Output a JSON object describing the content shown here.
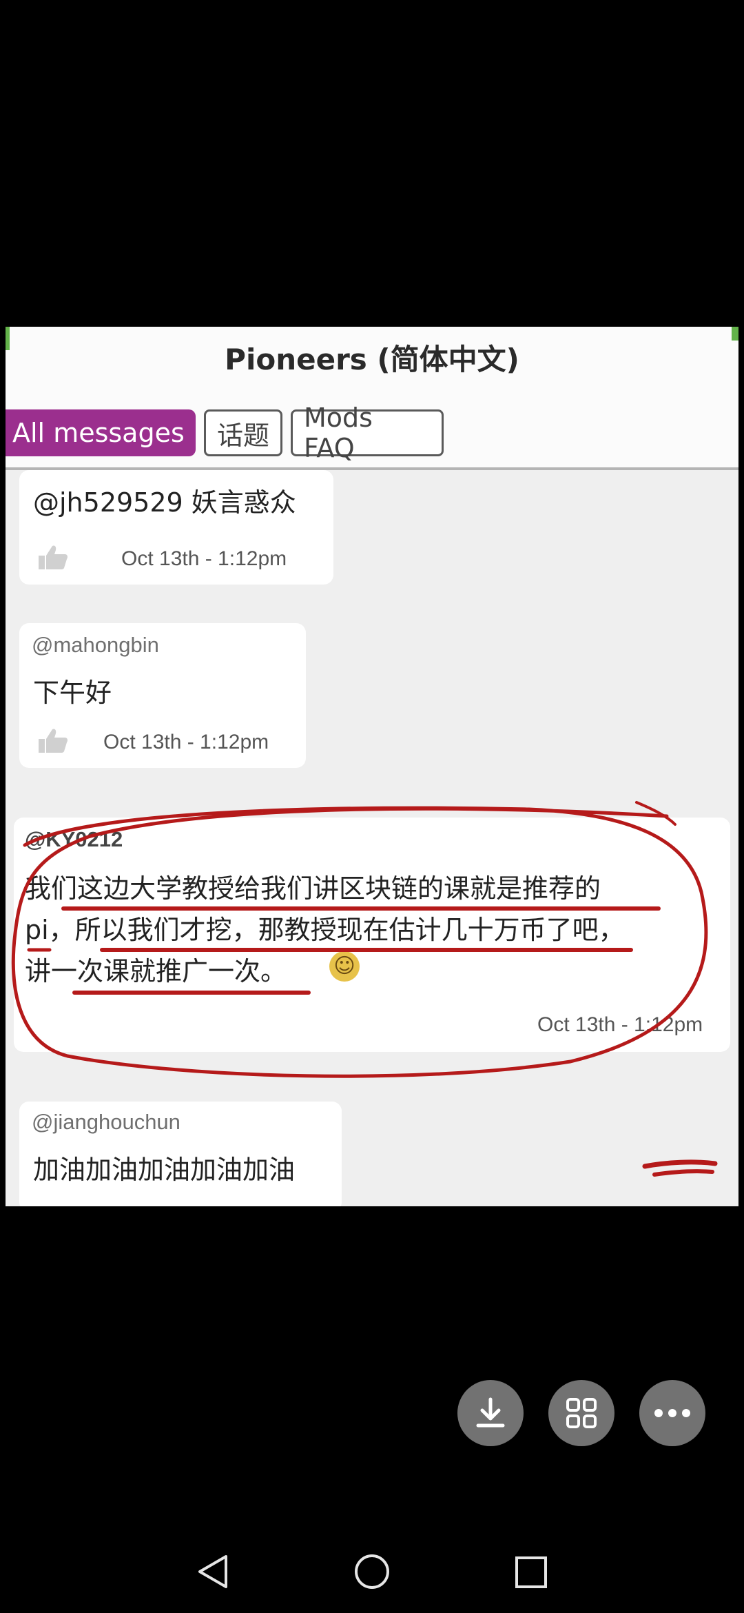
{
  "chat": {
    "title": "Pioneers (简体中文)",
    "tabs": [
      {
        "label": "All messages",
        "active": true
      },
      {
        "label": "话题",
        "active": false
      },
      {
        "label": "Mods FAQ",
        "active": false
      }
    ],
    "messages": [
      {
        "author": "",
        "text": "@jh529529 妖言惑众",
        "time": "Oct 13th - 1:12pm"
      },
      {
        "author": "@mahongbin",
        "text": "下午好",
        "time": "Oct 13th - 1:12pm"
      },
      {
        "author": "@KY0212",
        "lines": [
          "我们这边大学教授给我们讲区块链的课就是推荐的",
          "pi，所以我们才挖，那教授现在估计几十万币了吧，",
          "讲一次课就推广一次。"
        ],
        "time": "Oct 13th - 1:12pm"
      },
      {
        "author": "@jianghouchun",
        "text": "加油加油加油加油加油"
      }
    ]
  },
  "viewer": {
    "buttons": [
      {
        "icon": "download-icon"
      },
      {
        "icon": "grid-icon"
      },
      {
        "icon": "more-icon"
      }
    ]
  },
  "navbar": {
    "buttons": [
      {
        "icon": "back-triangle-icon"
      },
      {
        "icon": "home-circle-icon"
      },
      {
        "icon": "recents-square-icon"
      }
    ]
  },
  "colors": {
    "accent": "#9b2f8e",
    "annotation_red": "#b51a1a",
    "fab_gray": "#727272"
  }
}
